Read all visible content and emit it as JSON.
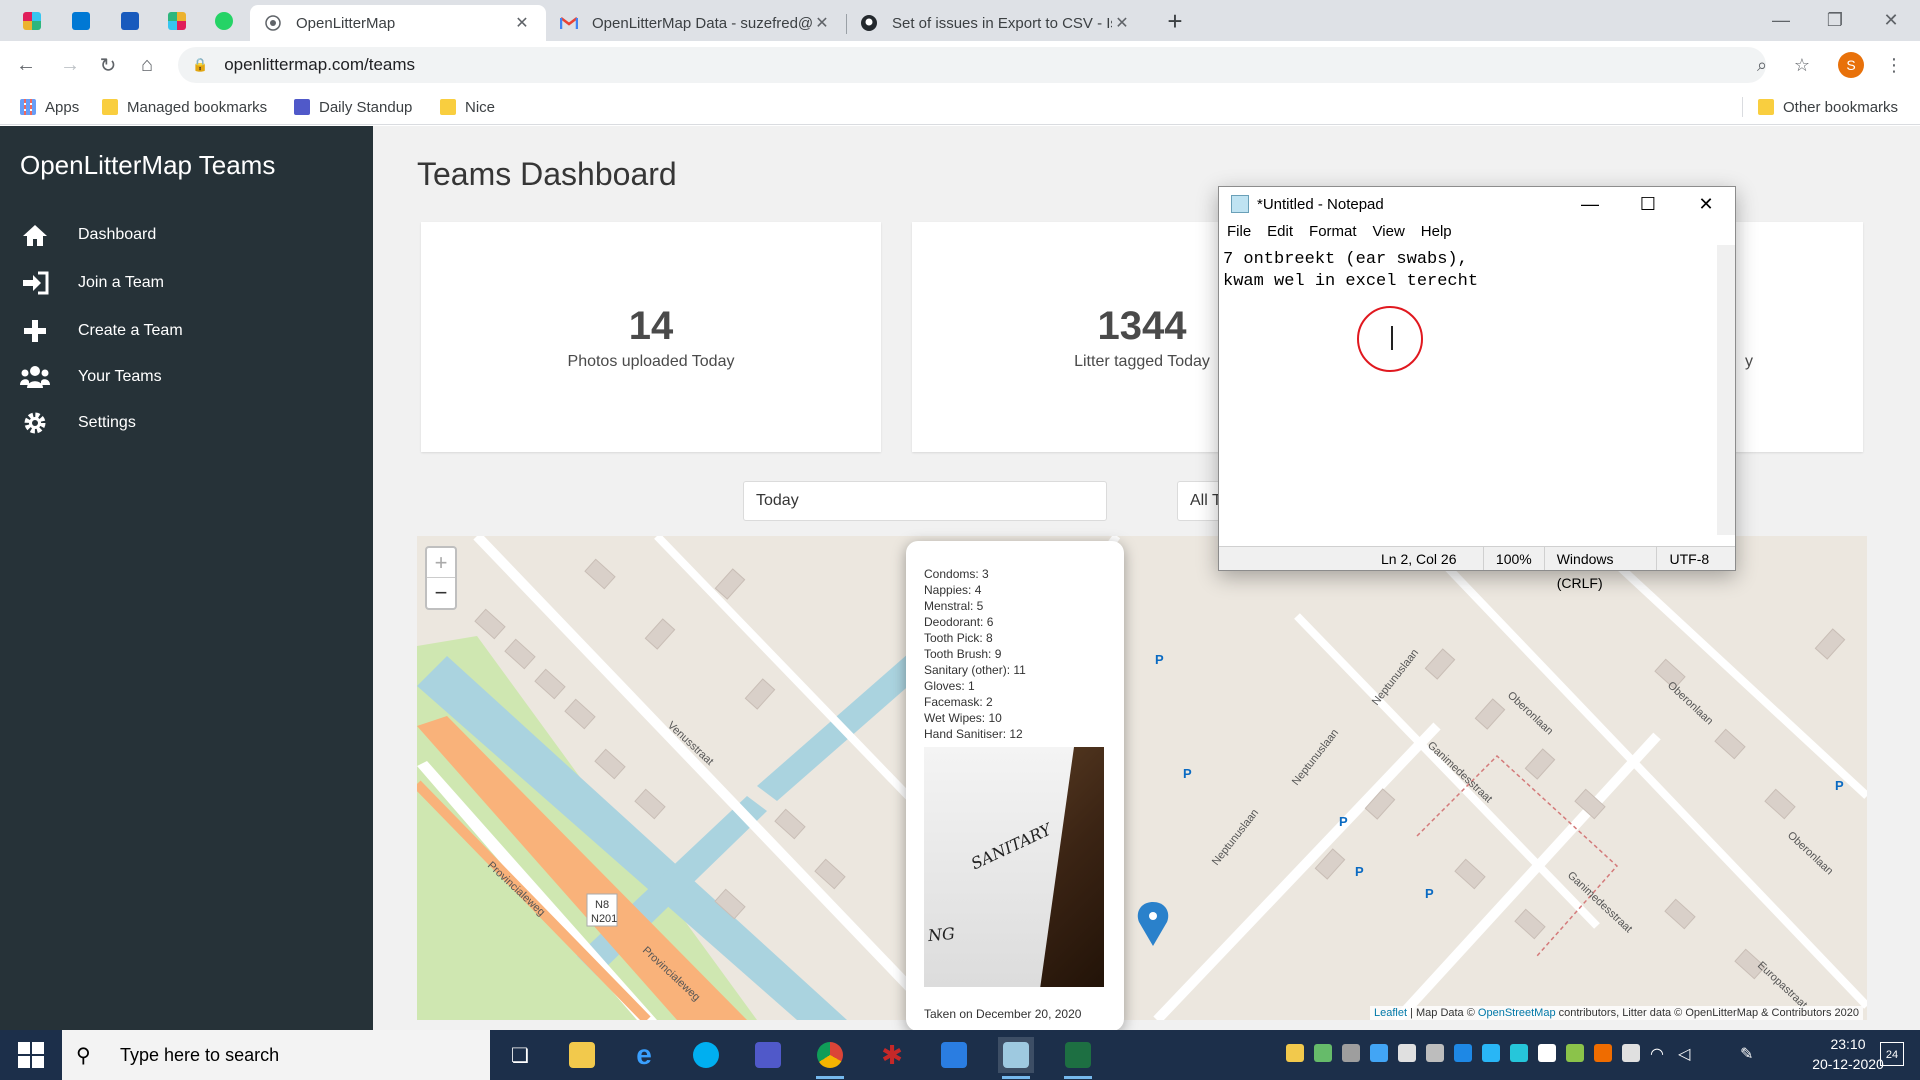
{
  "browser": {
    "pinned_tabs": [
      {
        "name": "slack-icon",
        "color": "#4a154b"
      },
      {
        "name": "outlook-icon",
        "color": "#0078d4"
      },
      {
        "name": "planner-icon",
        "color": "#185abd"
      },
      {
        "name": "slack-icon-2",
        "color": "#36c5f0"
      },
      {
        "name": "whatsapp-icon",
        "color": "#25d366"
      }
    ],
    "tabs": [
      {
        "title": "OpenLitterMap",
        "active": true,
        "icon": "globe-icon"
      },
      {
        "title": "OpenLitterMap Data - suzefred@",
        "active": false,
        "icon": "gmail-icon"
      },
      {
        "title": "Set of issues in Export to CSV - Is",
        "active": false,
        "icon": "github-icon"
      }
    ],
    "url": "openlittermap.com/teams",
    "profile_initial": "S",
    "bookmarks": [
      {
        "label": "Apps",
        "icon": "apps-grid-icon"
      },
      {
        "label": "Managed bookmarks",
        "icon": "folder-icon"
      },
      {
        "label": "Daily Standup",
        "icon": "teams-icon"
      },
      {
        "label": "Nice",
        "icon": "folder-icon"
      }
    ],
    "other_bookmarks": "Other bookmarks"
  },
  "sidebar": {
    "brand": "OpenLitterMap Teams",
    "items": [
      {
        "label": "Dashboard",
        "icon": "home-icon"
      },
      {
        "label": "Join a Team",
        "icon": "sign-in-icon"
      },
      {
        "label": "Create a Team",
        "icon": "plus-icon"
      },
      {
        "label": "Your Teams",
        "icon": "users-icon"
      },
      {
        "label": "Settings",
        "icon": "gear-icon"
      }
    ]
  },
  "dashboard": {
    "title": "Teams Dashboard",
    "cards": [
      {
        "value": "14",
        "label": "Photos uploaded Today"
      },
      {
        "value": "1344",
        "label": "Litter tagged Today"
      },
      {
        "value": "",
        "label": "y"
      }
    ],
    "period_select": "Today",
    "team_select": "All T"
  },
  "map": {
    "zoom_in": "+",
    "zoom_out": "−",
    "attribution_leaflet": "Leaflet",
    "attribution_rest": " | Map Data © ",
    "attribution_osm": "OpenStreetMap",
    "attribution_tail": " contributors, Litter data © OpenLitterMap & Contributors 2020",
    "street_labels": [
      "Venusstraat",
      "Provincialeweg",
      "Provincialeweg",
      "Neptunuslaan",
      "Neptunuslaan",
      "Neptunuslaan",
      "Ganimedesstraat",
      "Ganimedesstraat",
      "Oberonlaan",
      "Oberonlaan",
      "Oberonlaan",
      "Europastraat",
      "N8",
      "N201"
    ],
    "popup": {
      "items": [
        "Condoms: 3",
        "Nappies: 4",
        "Menstral: 5",
        "Deodorant: 6",
        "Tooth Pick: 8",
        "Tooth Brush: 9",
        "Sanitary (other): 11",
        "Gloves: 1",
        "Facemask: 2",
        "Wet Wipes: 10",
        "Hand Sanitiser: 12"
      ],
      "photo_text": [
        "SANITARY",
        "NG"
      ],
      "taken": "Taken on December 20, 2020"
    }
  },
  "notepad": {
    "title": "*Untitled - Notepad",
    "menu": [
      "File",
      "Edit",
      "Format",
      "View",
      "Help"
    ],
    "text_line1": "7 ontbreekt (ear swabs),",
    "text_line2": "kwam wel in excel terecht",
    "status": {
      "position": "Ln 2, Col 26",
      "zoom": "100%",
      "line_ending": "Windows (CRLF)",
      "encoding": "UTF-8"
    }
  },
  "taskbar": {
    "search_placeholder": "Type here to search",
    "apps": [
      {
        "name": "task-view-icon",
        "color": "#1c2f4a"
      },
      {
        "name": "file-explorer-icon",
        "color": "#f2c94c"
      },
      {
        "name": "edge-legacy-icon",
        "color": "#1e88e5"
      },
      {
        "name": "skype-icon",
        "color": "#00aff0"
      },
      {
        "name": "teams-icon",
        "color": "#5059c9"
      },
      {
        "name": "chrome-icon",
        "color": "#db4437"
      },
      {
        "name": "app-red-icon",
        "color": "#c62828"
      },
      {
        "name": "photos-icon",
        "color": "#2a7de1"
      },
      {
        "name": "notepad-icon",
        "color": "#9ec9e0"
      },
      {
        "name": "excel-icon",
        "color": "#1d6f42"
      }
    ],
    "time": "23:10",
    "date": "20-12-2020",
    "notifications": "24"
  }
}
